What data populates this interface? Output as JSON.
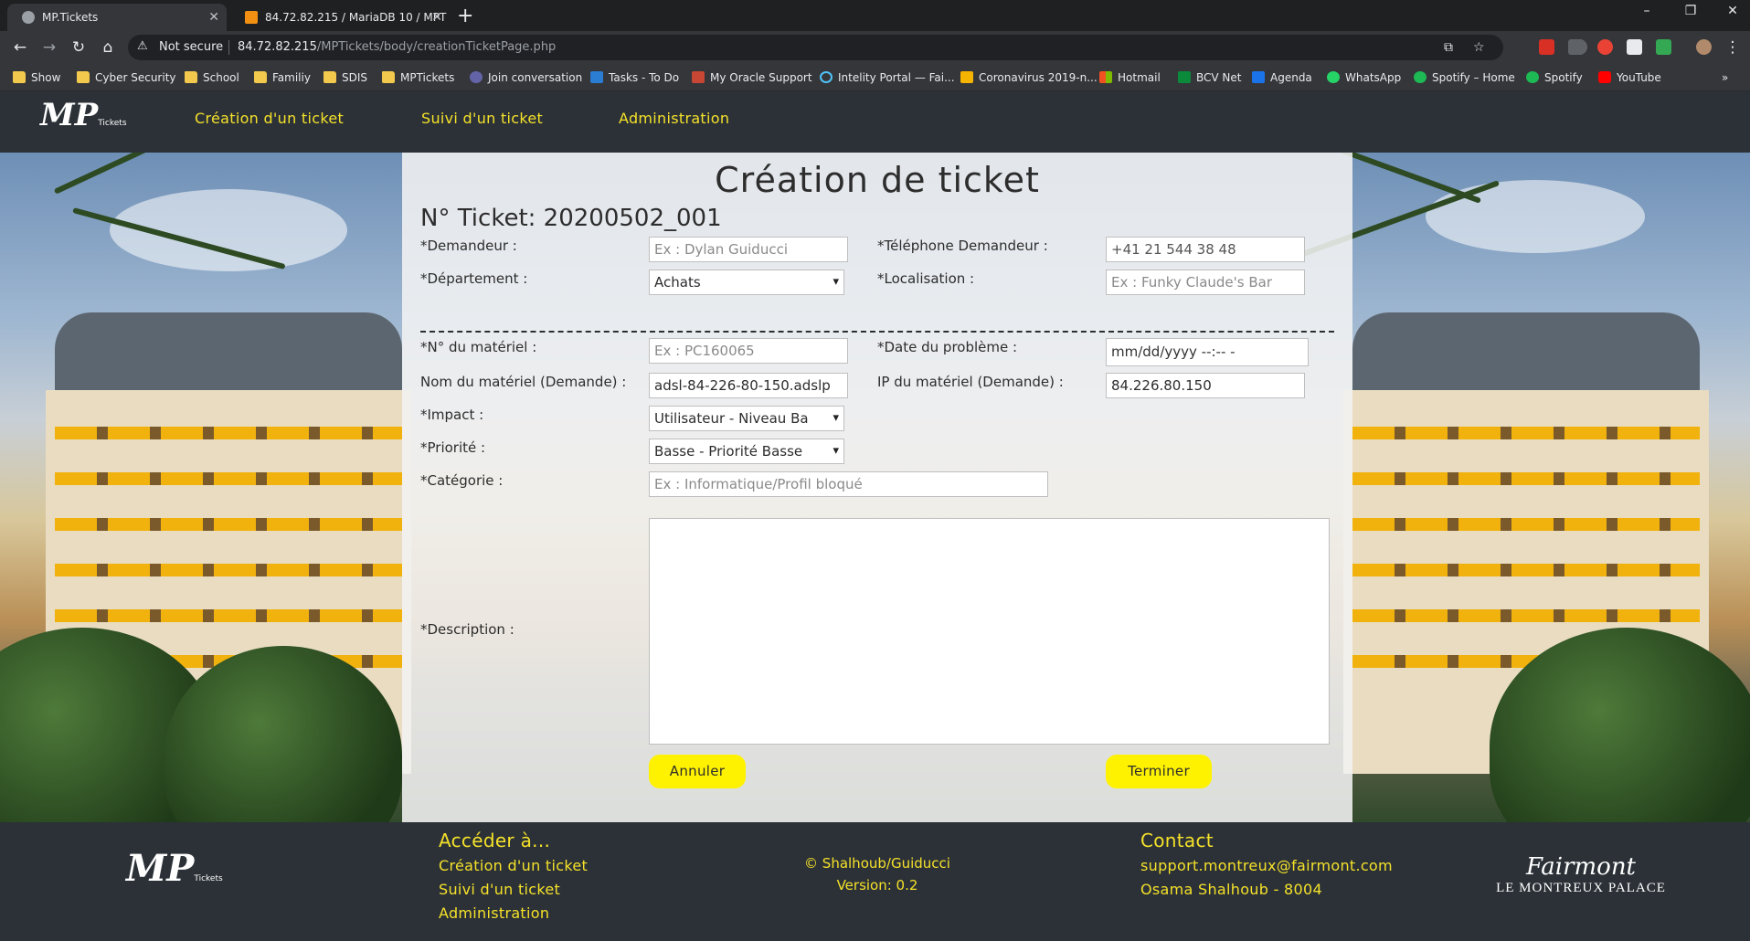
{
  "browser": {
    "tabs": [
      {
        "title": "MP.Tickets",
        "active": true,
        "icon": "globe-icon"
      },
      {
        "title": "84.72.82.215 / MariaDB 10 / MPT",
        "active": false,
        "icon": "phpmyadmin-icon"
      }
    ],
    "security_label": "Not secure",
    "url_host": "84.72.82.215",
    "url_path": "/MPTickets/body/creationTicketPage.php",
    "bookmarks": [
      {
        "label": "Show",
        "icon": "folder-icon"
      },
      {
        "label": "Cyber Security",
        "icon": "folder-icon"
      },
      {
        "label": "School",
        "icon": "folder-icon"
      },
      {
        "label": "Familiy",
        "icon": "folder-icon"
      },
      {
        "label": "SDIS",
        "icon": "folder-icon"
      },
      {
        "label": "MPTickets",
        "icon": "folder-icon"
      },
      {
        "label": "Join conversation",
        "icon": "teams-icon"
      },
      {
        "label": "Tasks - To Do",
        "icon": "todo-icon"
      },
      {
        "label": "My Oracle Support",
        "icon": "oracle-icon"
      },
      {
        "label": "Intelity Portal — Fai...",
        "icon": "loading-icon"
      },
      {
        "label": "Coronavirus 2019-n...",
        "icon": "cdc-icon"
      },
      {
        "label": "Hotmail",
        "icon": "microsoft-icon"
      },
      {
        "label": "BCV Net",
        "icon": "bcv-icon"
      },
      {
        "label": "Agenda",
        "icon": "calendar-icon"
      },
      {
        "label": "WhatsApp",
        "icon": "whatsapp-icon"
      },
      {
        "label": "Spotify – Home",
        "icon": "spotify-icon"
      },
      {
        "label": "Spotify",
        "icon": "spotify-icon"
      },
      {
        "label": "YouTube",
        "icon": "youtube-icon"
      }
    ]
  },
  "site": {
    "logo_text": "MP",
    "logo_sub": "Tickets",
    "nav": [
      "Création d'un ticket",
      "Suivi d'un ticket",
      "Administration"
    ]
  },
  "form": {
    "title": "Création de ticket",
    "ticket_number": "N° Ticket: 20200502_001",
    "demandeur": {
      "label": "*Demandeur :",
      "placeholder": "Ex : Dylan Guiducci"
    },
    "telephone": {
      "label": "*Téléphone Demandeur :",
      "value": "+41 21 544 38 48"
    },
    "departement": {
      "label": "*Département :",
      "value": "Achats"
    },
    "localisation": {
      "label": "*Localisation :",
      "placeholder": "Ex : Funky Claude's Bar"
    },
    "materiel_no": {
      "label": "*N° du matériel :",
      "placeholder": "Ex : PC160065"
    },
    "date_probleme": {
      "label": "*Date du problème :",
      "placeholder": "mm/dd/yyyy --:-- -"
    },
    "materiel_nom": {
      "label": "Nom du matériel (Demande) :",
      "value": "adsl-84-226-80-150.adslp"
    },
    "materiel_ip": {
      "label": "IP du matériel (Demande) :",
      "value": "84.226.80.150"
    },
    "impact": {
      "label": "*Impact :",
      "value": "Utilisateur - Niveau Ba"
    },
    "priorite": {
      "label": "*Priorité :",
      "value": "Basse - Priorité Basse"
    },
    "categorie": {
      "label": "*Catégorie :",
      "placeholder": "Ex : Informatique/Profil bloqué"
    },
    "description": {
      "label": "*Description :",
      "value": ""
    },
    "cancel_label": "Annuler",
    "submit_label": "Terminer"
  },
  "footer": {
    "access_heading": "Accéder à...",
    "access_links": [
      "Création d'un ticket",
      "Suivi d'un ticket",
      "Administration"
    ],
    "copyright": "© Shalhoub/Guiducci",
    "version": "Version: 0.2",
    "contact_heading": "Contact",
    "contact_email": "support.montreux@fairmont.com",
    "contact_person": "Osama Shalhoub - 8004",
    "partner_script": "Fairmont",
    "partner_name": "LE MONTREUX PALACE"
  },
  "colors": {
    "accent_yellow": "#f5e12a",
    "button_yellow": "#fff200",
    "header_bg": "#2b3137"
  }
}
